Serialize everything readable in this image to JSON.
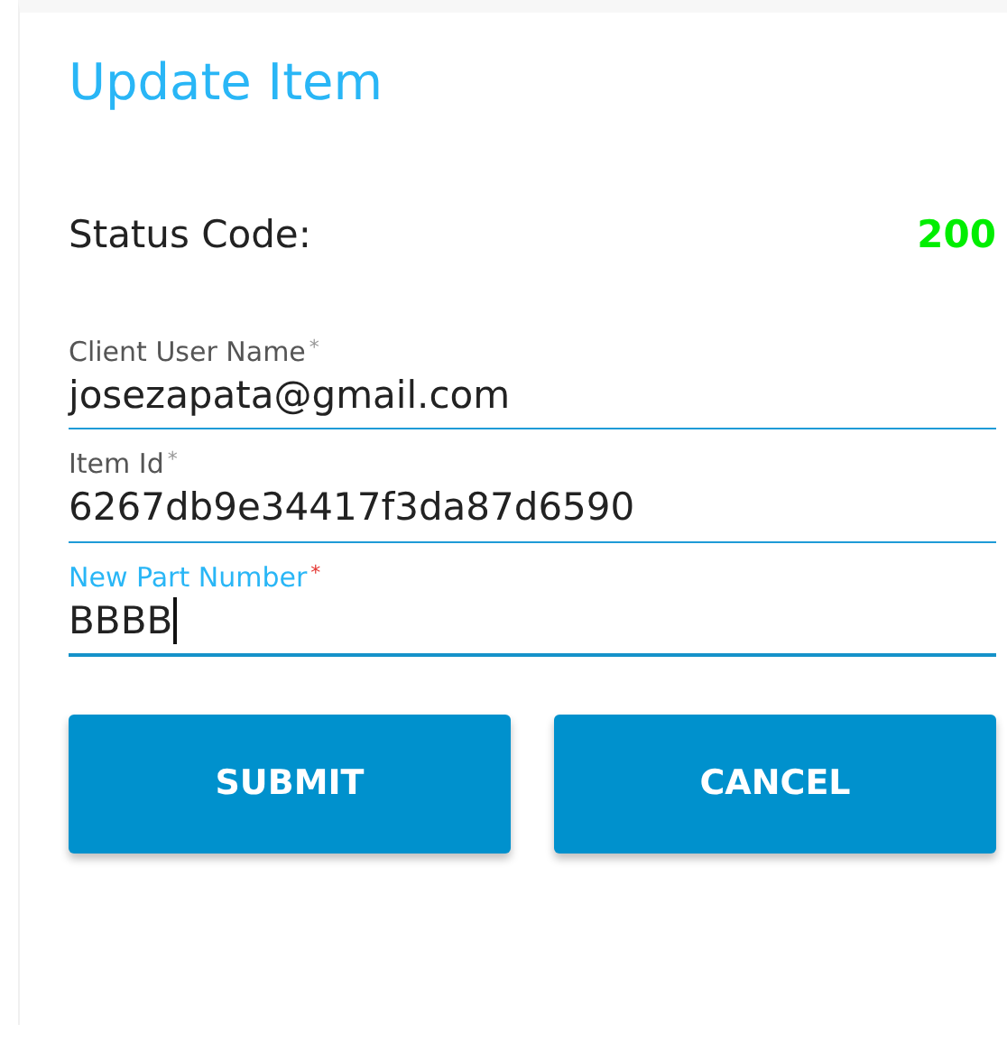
{
  "title": "Update Item",
  "status": {
    "label": "Status Code:",
    "value": "200",
    "color": "#00ee00"
  },
  "fields": [
    {
      "label": "Client User Name",
      "required_mark": "*",
      "value": "josezapata@gmail.com",
      "focused": false
    },
    {
      "label": "Item Id",
      "required_mark": "*",
      "value": "6267db9e34417f3da87d6590",
      "focused": false
    },
    {
      "label": "New Part Number",
      "required_mark": "*",
      "value": "BBBB",
      "focused": true
    }
  ],
  "buttons": [
    {
      "label": "SUBMIT"
    },
    {
      "label": "CANCEL"
    }
  ]
}
